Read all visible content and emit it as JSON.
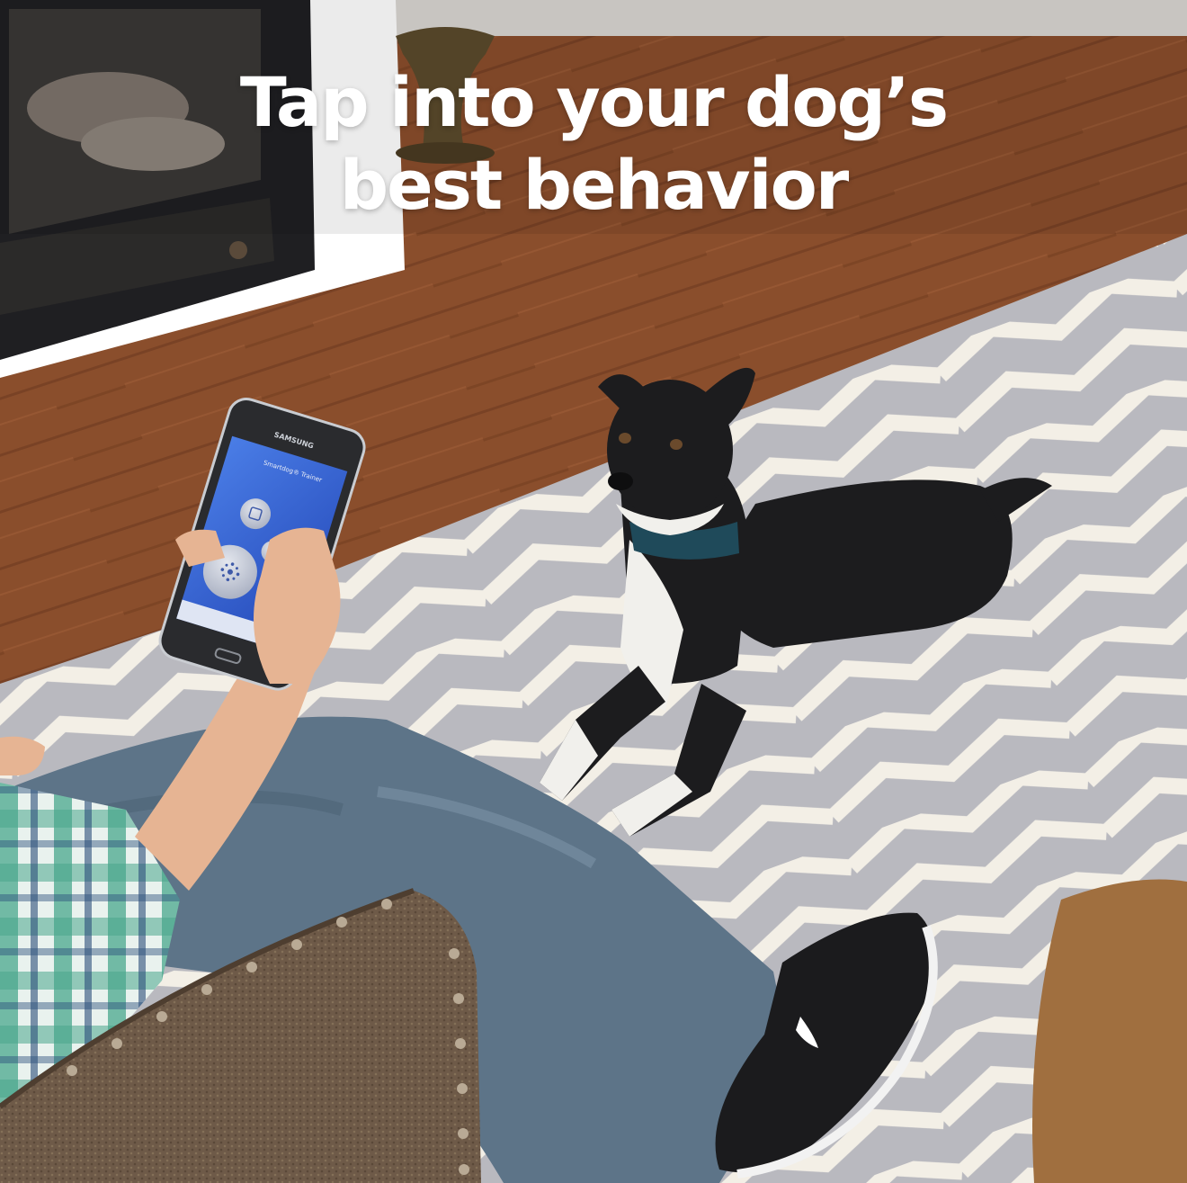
{
  "headline": {
    "line1": "Tap into your dog’s",
    "line2": "best behavior"
  },
  "phone": {
    "brand": "SAMSUNG",
    "app_title": "Smartdog® Trainer"
  },
  "colors": {
    "headline_text": "#ffffff",
    "floor_wood": "#8a4e2c",
    "rug_gray": "#b9b9bf",
    "rug_white": "#f3efe6",
    "app_blue": "#2f5fd6",
    "dog_black": "#1c1c1e",
    "collar_teal": "#1f4a5a",
    "jeans": "#5d7488",
    "chair_brown": "#6e5a48"
  },
  "icons": {
    "vibrate_button": "vibrate-icon",
    "tone_button": "speaker-icon",
    "stimulation_button": "static-burst-icon"
  }
}
